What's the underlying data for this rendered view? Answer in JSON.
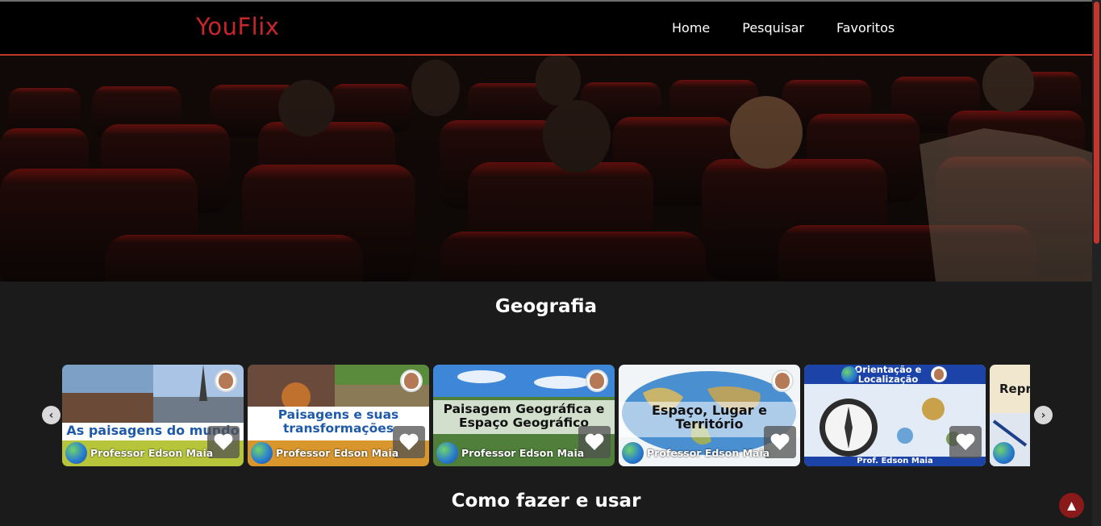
{
  "header": {
    "logo": "YouFlix",
    "nav": [
      {
        "label": "Home"
      },
      {
        "label": "Pesquisar"
      },
      {
        "label": "Favoritos"
      }
    ]
  },
  "sections": [
    {
      "title": "Geografia",
      "cards": [
        {
          "title": "As paisagens do mundo",
          "footer": "Professor Edson Maia"
        },
        {
          "title": "Paisagens e suas transformações",
          "footer": "Professor Edson Maia"
        },
        {
          "title": "Paisagem Geográfica e Espaço Geográfico",
          "footer": "Professor Edson Maia"
        },
        {
          "title": "Espaço, Lugar e Território",
          "footer": "Professor Edson Maia"
        },
        {
          "title": "Orientação e Localização",
          "footer": "Prof. Edson Maia"
        },
        {
          "title": "Repr"
        }
      ]
    },
    {
      "title": "Como fazer e usar"
    }
  ],
  "colors": {
    "brand": "#c8262b",
    "header_border": "#c0392b",
    "background": "#1b1b1b"
  },
  "icons": {
    "prev": "chevron-left-icon",
    "next": "chevron-right-icon",
    "favorite": "heart-icon",
    "to_top": "arrow-up-icon"
  }
}
